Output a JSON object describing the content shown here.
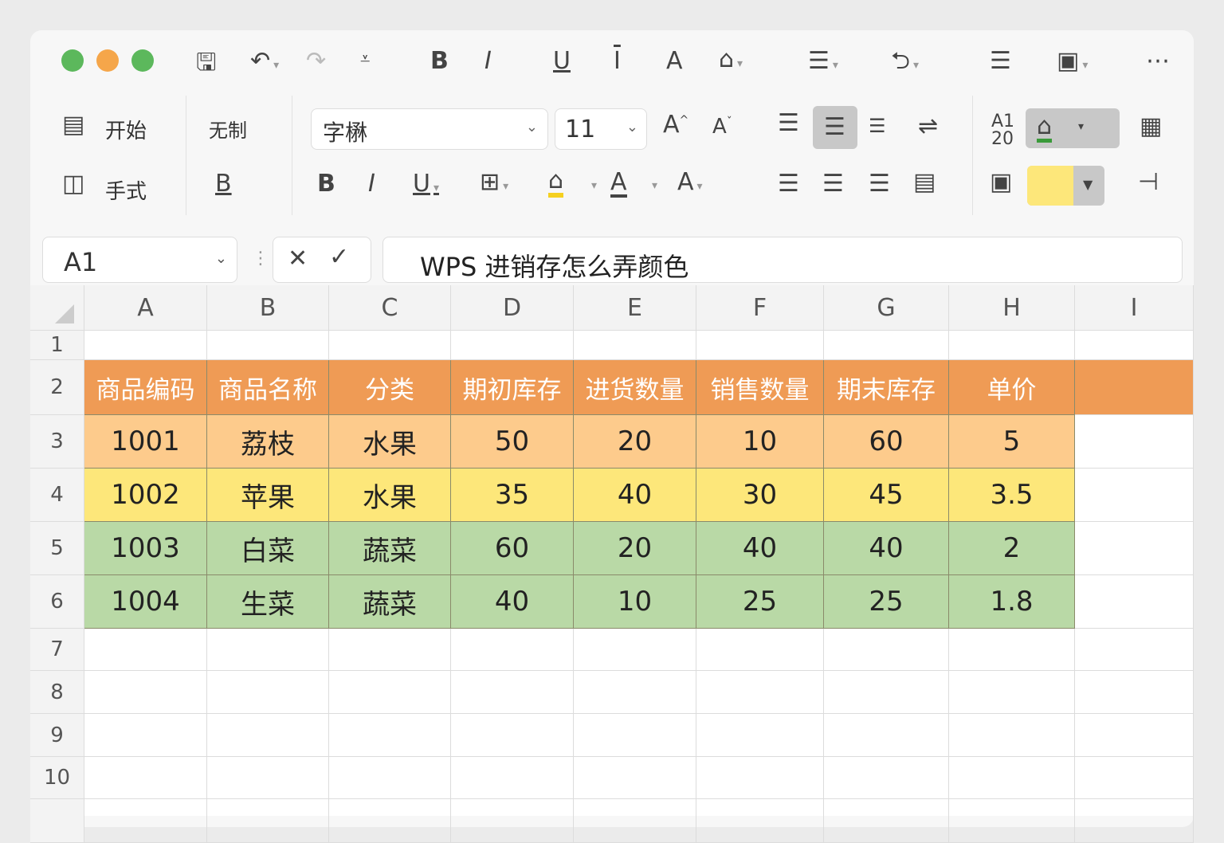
{
  "window": {
    "controls": [
      "close",
      "minimize",
      "maximize"
    ]
  },
  "toolbar": {
    "ribbon_tabs": [
      {
        "label": "开始",
        "icon": "page-icon"
      },
      {
        "label": "手式",
        "icon": "note-icon"
      }
    ],
    "group_label": "无制",
    "font_name": "字楙",
    "font_size": "11",
    "fill_color": "#fde77a",
    "font_color_bar": "#f5d020"
  },
  "formula_bar": {
    "name_box": "A1",
    "formula": "WPS 进销存怎么弄颜色"
  },
  "sheet": {
    "columns": [
      "A",
      "B",
      "C",
      "D",
      "E",
      "F",
      "G",
      "H",
      "I"
    ],
    "row_numbers": [
      "1",
      "2",
      "3",
      "4",
      "5",
      "6",
      "7",
      "8",
      "9",
      "10"
    ],
    "header": [
      "商品编码",
      "商品名称",
      "分类",
      "期初库存",
      "进货数量",
      "销售数量",
      "期末库存",
      "单价"
    ],
    "rows": [
      [
        "1001",
        "荔枝",
        "水果",
        "50",
        "20",
        "10",
        "60",
        "5"
      ],
      [
        "1002",
        "苹果",
        "水果",
        "35",
        "40",
        "30",
        "45",
        "3.5"
      ],
      [
        "1003",
        "白菜",
        "蔬菜",
        "60",
        "20",
        "40",
        "40",
        "2"
      ],
      [
        "1004",
        "生菜",
        "蔬菜",
        "40",
        "10",
        "25",
        "25",
        "1.8"
      ]
    ],
    "colors": {
      "header": "#ef9b55",
      "row_fills": [
        "#fdcb8c",
        "#fde77a",
        "#b9d9a6",
        "#b9d9a6"
      ]
    }
  }
}
